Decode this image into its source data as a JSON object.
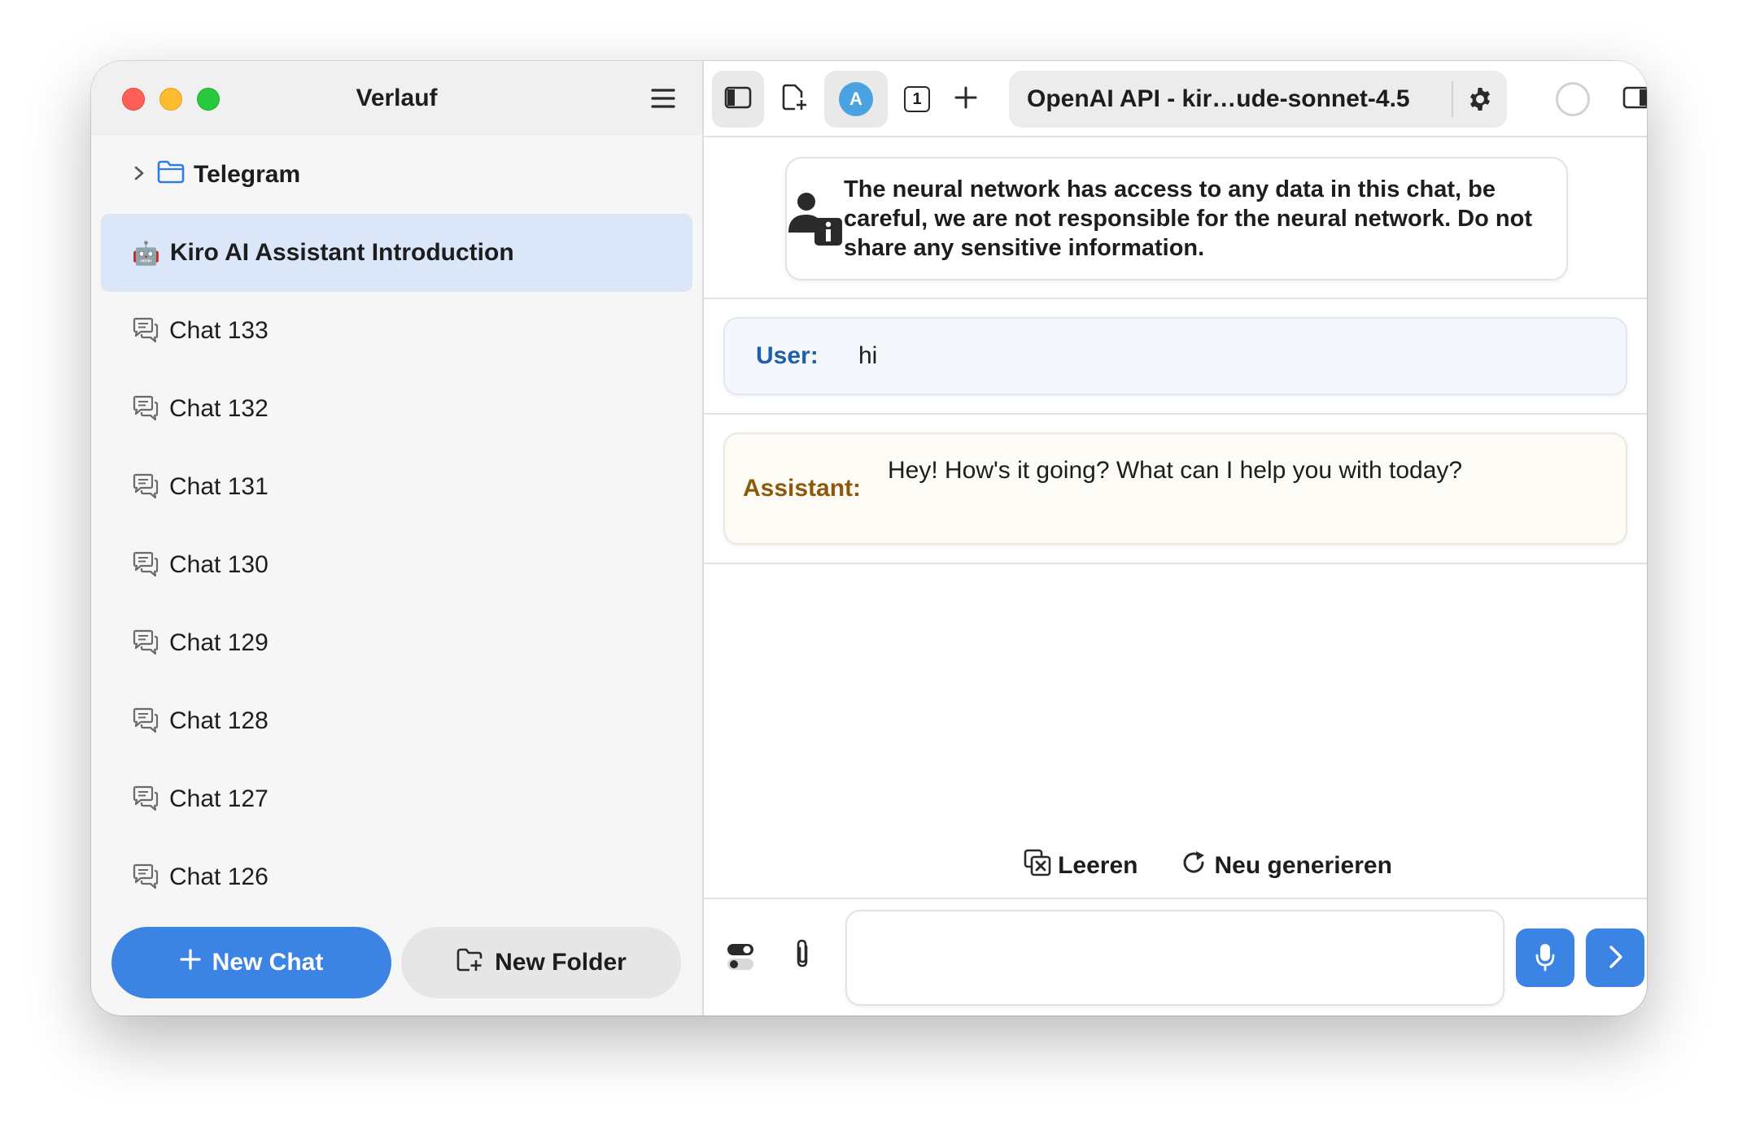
{
  "sidebar": {
    "title": "Verlauf",
    "folder": {
      "name": "Telegram"
    },
    "active_chat": {
      "emoji": "🤖",
      "label": "Kiro AI Assistant Introduction"
    },
    "chats": [
      "Chat 133",
      "Chat 132",
      "Chat 131",
      "Chat 130",
      "Chat 129",
      "Chat 128",
      "Chat 127",
      "Chat 126"
    ],
    "new_chat_label": "New Chat",
    "new_folder_label": "New Folder"
  },
  "toolbar": {
    "avatar_letter": "A",
    "tab_count": "1",
    "model_label": "OpenAI API - kir…ude-sonnet-4.5"
  },
  "notice": {
    "text": "The neural network has access to any data in this chat, be careful, we are not responsible for the neural network. Do not share any sensitive information."
  },
  "messages": {
    "user_role": "User:",
    "user_text": "hi",
    "assistant_role": "Assistant:",
    "assistant_text": "Hey! How's it going? What can I help you with today?"
  },
  "actions": {
    "clear_label": "Leeren",
    "regenerate_label": "Neu generieren"
  },
  "composer": {
    "input_value": "",
    "placeholder": ""
  },
  "colors": {
    "accent": "#3c84e4",
    "active_row": "#dbe7f8",
    "user_role": "#1f5fab",
    "assistant_role": "#8c5a0a"
  }
}
